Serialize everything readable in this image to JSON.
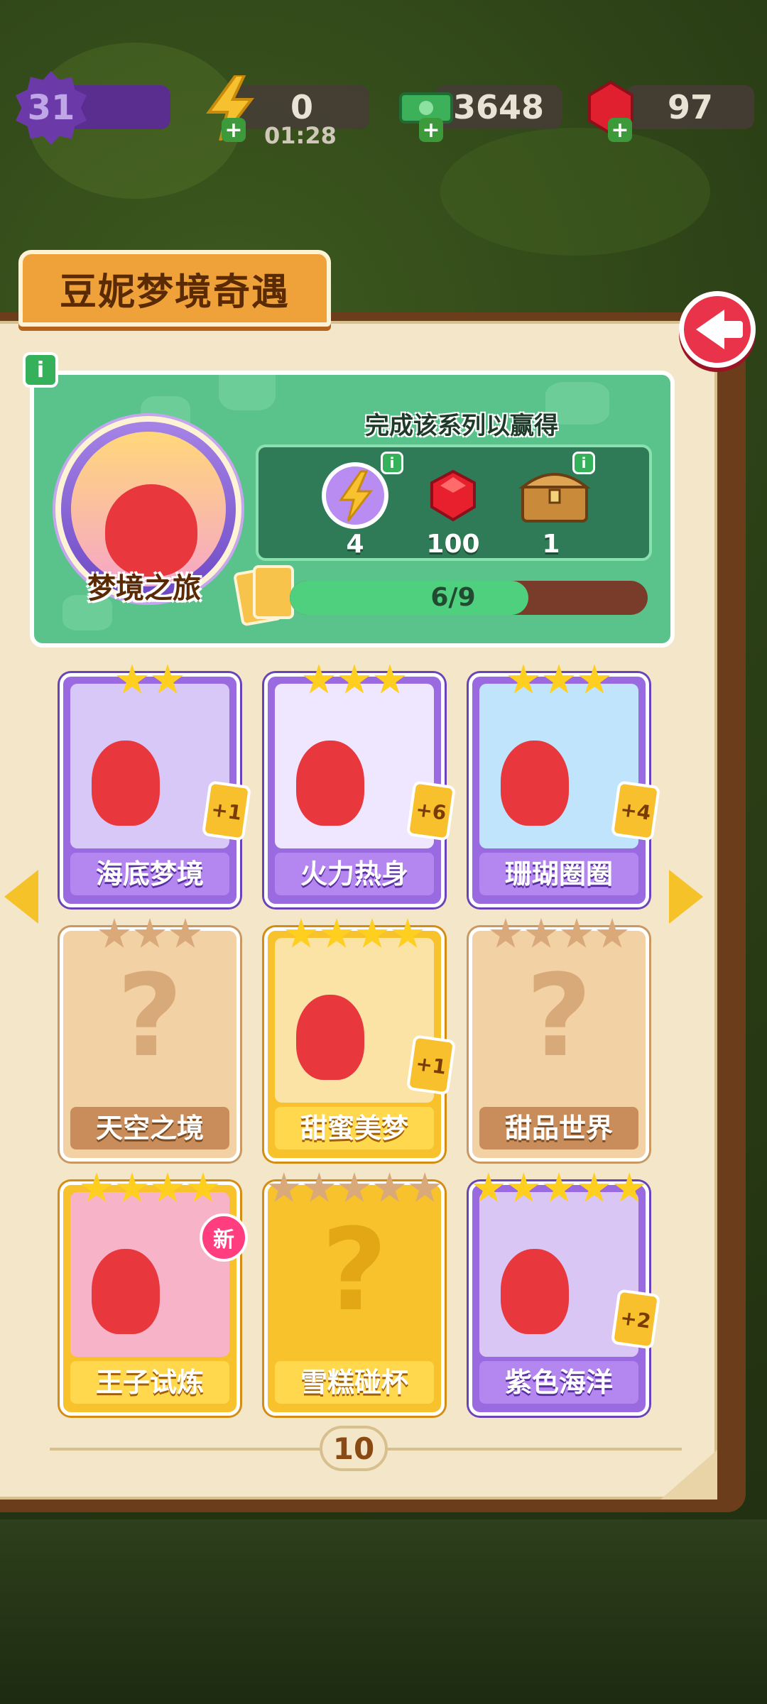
{
  "hud": {
    "level": "31",
    "energy": "0",
    "energy_timer": "01:28",
    "cash": "3648",
    "gems": "97"
  },
  "album": {
    "title": "豆妮梦境奇遇",
    "medal_label": "梦境之旅",
    "reward_title": "完成该系列以赢得",
    "rewards": [
      {
        "icon": "energy-bolt-icon",
        "value": "4"
      },
      {
        "icon": "ruby-gem-icon",
        "value": "100"
      },
      {
        "icon": "treasure-chest-icon",
        "value": "1"
      }
    ],
    "progress_text": "6/9",
    "progress_fraction": 0.667,
    "page_number": "10"
  },
  "cards": [
    {
      "label": "海底梦境",
      "stars": 2,
      "max_stars": 2,
      "style": "purple",
      "count": "+1",
      "new": false,
      "art": "#d8c8f7"
    },
    {
      "label": "火力热身",
      "stars": 3,
      "max_stars": 3,
      "style": "purple",
      "count": "+6",
      "new": false,
      "art": "#efe6ff"
    },
    {
      "label": "珊瑚圈圈",
      "stars": 3,
      "max_stars": 3,
      "style": "purple",
      "count": "+4",
      "new": false,
      "art": "#bfe4fb"
    },
    {
      "label": "天空之境",
      "stars": 0,
      "max_stars": 3,
      "style": "locked",
      "count": "",
      "new": false,
      "art": ""
    },
    {
      "label": "甜蜜美梦",
      "stars": 4,
      "max_stars": 4,
      "style": "gold",
      "count": "+1",
      "new": false,
      "art": "#fbe3a6"
    },
    {
      "label": "甜品世界",
      "stars": 0,
      "max_stars": 4,
      "style": "locked",
      "count": "",
      "new": false,
      "art": ""
    },
    {
      "label": "王子试炼",
      "stars": 4,
      "max_stars": 4,
      "style": "gold",
      "count": "",
      "new": true,
      "new_text": "新",
      "art": "#f7b4c9"
    },
    {
      "label": "雪糕碰杯",
      "stars": 0,
      "max_stars": 5,
      "style": "gold-locked",
      "count": "",
      "new": false,
      "art": ""
    },
    {
      "label": "紫色海洋",
      "stars": 5,
      "max_stars": 5,
      "style": "purple",
      "count": "+2",
      "new": false,
      "art": "#d9c6f5"
    }
  ],
  "colors": {
    "accent_orange": "#f0a23a",
    "back_red": "#e8334a",
    "panel_green": "#5ac38b",
    "card_purple": "#9a6be0",
    "card_gold": "#f8c22c"
  }
}
